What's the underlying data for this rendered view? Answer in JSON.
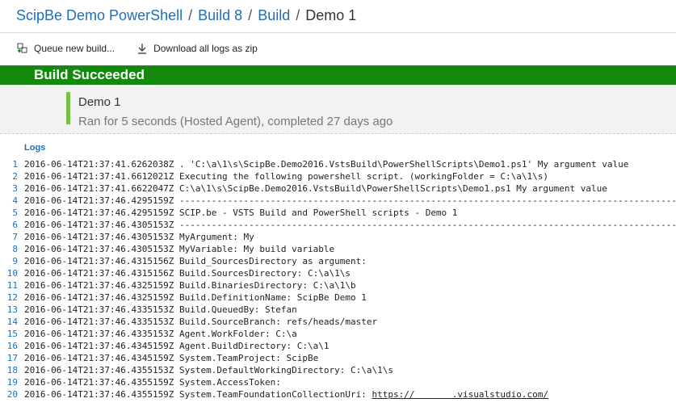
{
  "breadcrumb": {
    "project": "ScipBe Demo PowerShell",
    "build": "Build 8",
    "step": "Build",
    "current": "Demo 1",
    "separator": "/"
  },
  "toolbar": {
    "queue_label": "Queue new build...",
    "download_label": "Download all logs as zip"
  },
  "banner": {
    "text": "Build Succeeded",
    "color": "#138a0e"
  },
  "summary": {
    "job_name": "Demo 1",
    "status": "Ran for 5 seconds (Hosted Agent), completed 27 days ago"
  },
  "logs": {
    "label": "Logs",
    "lines": [
      {
        "num": "1",
        "text": "2016-06-14T21:37:41.6262038Z . 'C:\\a\\1\\s\\ScipBe.Demo2016.VstsBuild\\PowerShellScripts\\Demo1.ps1' My argument value"
      },
      {
        "num": "2",
        "text": "2016-06-14T21:37:41.6612021Z Executing the following powershell script. (workingFolder = C:\\a\\1\\s)"
      },
      {
        "num": "3",
        "text": "2016-06-14T21:37:41.6622047Z C:\\a\\1\\s\\ScipBe.Demo2016.VstsBuild\\PowerShellScripts\\Demo1.ps1 My argument value"
      },
      {
        "num": "4",
        "text": "2016-06-14T21:37:46.4295159Z ----------------------------------------------------------------------------------------------"
      },
      {
        "num": "5",
        "text": "2016-06-14T21:37:46.4295159Z SCIP.be - VSTS Build and PowerShell scripts - Demo 1"
      },
      {
        "num": "6",
        "text": "2016-06-14T21:37:46.4305153Z ----------------------------------------------------------------------------------------------"
      },
      {
        "num": "7",
        "text": "2016-06-14T21:37:46.4305153Z MyArgument: My"
      },
      {
        "num": "8",
        "text": "2016-06-14T21:37:46.4305153Z MyVariable: My build variable"
      },
      {
        "num": "9",
        "text": "2016-06-14T21:37:46.4315156Z Build_SourcesDirectory as argument:"
      },
      {
        "num": "10",
        "text": "2016-06-14T21:37:46.4315156Z Build.SourcesDirectory: C:\\a\\1\\s"
      },
      {
        "num": "11",
        "text": "2016-06-14T21:37:46.4325159Z Build.BinariesDirectory: C:\\a\\1\\b"
      },
      {
        "num": "12",
        "text": "2016-06-14T21:37:46.4325159Z Build.DefinitionName: ScipBe Demo 1"
      },
      {
        "num": "13",
        "text": "2016-06-14T21:37:46.4335153Z Build.QueuedBy: Stefan"
      },
      {
        "num": "14",
        "text": "2016-06-14T21:37:46.4335153Z Build.SourceBranch: refs/heads/master"
      },
      {
        "num": "15",
        "text": "2016-06-14T21:37:46.4335153Z Agent.WorkFolder: C:\\a"
      },
      {
        "num": "16",
        "text": "2016-06-14T21:37:46.4345159Z Agent.BuildDirectory: C:\\a\\1"
      },
      {
        "num": "17",
        "text": "2016-06-14T21:37:46.4345159Z System.TeamProject: ScipBe"
      },
      {
        "num": "18",
        "text": "2016-06-14T21:37:46.4355153Z System.DefaultWorkingDirectory: C:\\a\\1\\s"
      },
      {
        "num": "19",
        "text": "2016-06-14T21:37:46.4355159Z System.AccessToken:"
      }
    ],
    "last_line": {
      "num": "20",
      "prefix": "2016-06-14T21:37:46.4355159Z System.TeamFoundationCollectionUri: ",
      "link": "https://       .visualstudio.com/"
    }
  }
}
